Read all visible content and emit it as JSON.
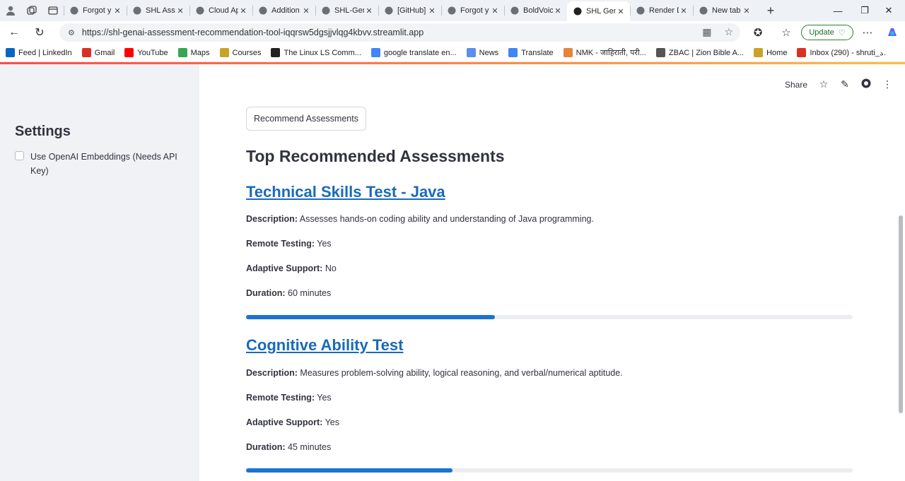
{
  "browser": {
    "tabs": [
      {
        "title": "Forgot y",
        "icon": "github-icon",
        "active": false
      },
      {
        "title": "SHL Asse",
        "icon": "globe-icon",
        "active": false
      },
      {
        "title": "Cloud Ap",
        "icon": "render-icon",
        "active": false
      },
      {
        "title": "Addition",
        "icon": "gmail-icon",
        "active": false
      },
      {
        "title": "SHL-Gen",
        "icon": "github-icon",
        "active": false
      },
      {
        "title": "[GitHub]",
        "icon": "gmail-icon",
        "active": false
      },
      {
        "title": "Forgot y",
        "icon": "github-icon",
        "active": false
      },
      {
        "title": "BoldVoic",
        "icon": "boldvoice-icon",
        "active": false
      },
      {
        "title": "SHL Gen",
        "icon": "streamlit-icon",
        "active": true
      },
      {
        "title": "Render D",
        "icon": "render-icon",
        "active": false
      },
      {
        "title": "New tab",
        "icon": "newtab-icon",
        "active": false
      }
    ],
    "url": "https://shl-genai-assessment-recommendation-tool-iqqrsw5dgsjjvlqg4kbvv.streamlit.app",
    "update_label": "Update",
    "bookmarks": [
      {
        "label": "Feed | LinkedIn",
        "icon": "linkedin-icon",
        "color": "#0a66c2"
      },
      {
        "label": "Gmail",
        "icon": "gmail-icon",
        "color": "#d93025"
      },
      {
        "label": "YouTube",
        "icon": "youtube-icon",
        "color": "#ff0000"
      },
      {
        "label": "Maps",
        "icon": "maps-icon",
        "color": "#34a853"
      },
      {
        "label": "Courses",
        "icon": "courses-icon",
        "color": "#c9a227"
      },
      {
        "label": "The Linux LS Comm...",
        "icon": "linux-icon",
        "color": "#222222"
      },
      {
        "label": "google translate en...",
        "icon": "google-icon",
        "color": "#4285f4"
      },
      {
        "label": "News",
        "icon": "news-icon",
        "color": "#5b8def"
      },
      {
        "label": "Translate",
        "icon": "translate-icon",
        "color": "#4285f4"
      },
      {
        "label": "NMK - जाहिराती, परी...",
        "icon": "nmk-icon",
        "color": "#e8833a"
      },
      {
        "label": "ZBAC | Zion Bible A...",
        "icon": "zbac-icon",
        "color": "#555555"
      },
      {
        "label": "Home",
        "icon": "home-icon",
        "color": "#c9a227"
      },
      {
        "label": "Inbox (290) - shruti_...",
        "icon": "gmail-icon",
        "color": "#d93025"
      }
    ]
  },
  "sidebar": {
    "title": "Settings",
    "checkbox_label": "Use OpenAI Embeddings (Needs API Key)",
    "checkbox_checked": false
  },
  "toolbar": {
    "share_label": "Share"
  },
  "main": {
    "button_label": "Recommend Assessments",
    "heading": "Top Recommended Assessments",
    "labels": {
      "description": "Description:",
      "remote": "Remote Testing:",
      "adaptive": "Adaptive Support:",
      "duration": "Duration:"
    },
    "assessments": [
      {
        "title": "Technical Skills Test - Java",
        "description": "Assesses hands-on coding ability and understanding of Java programming.",
        "remote_testing": "Yes",
        "adaptive_support": "No",
        "duration": "60 minutes",
        "progress": 0.41
      },
      {
        "title": "Cognitive Ability Test",
        "description": "Measures problem-solving ability, logical reasoning, and verbal/numerical aptitude.",
        "remote_testing": "Yes",
        "adaptive_support": "Yes",
        "duration": "45 minutes",
        "progress": 0.34
      }
    ]
  },
  "colors": {
    "accent": "#1b73d1",
    "link": "#1a6ab8",
    "sidebar_bg": "#f0f2f6"
  }
}
